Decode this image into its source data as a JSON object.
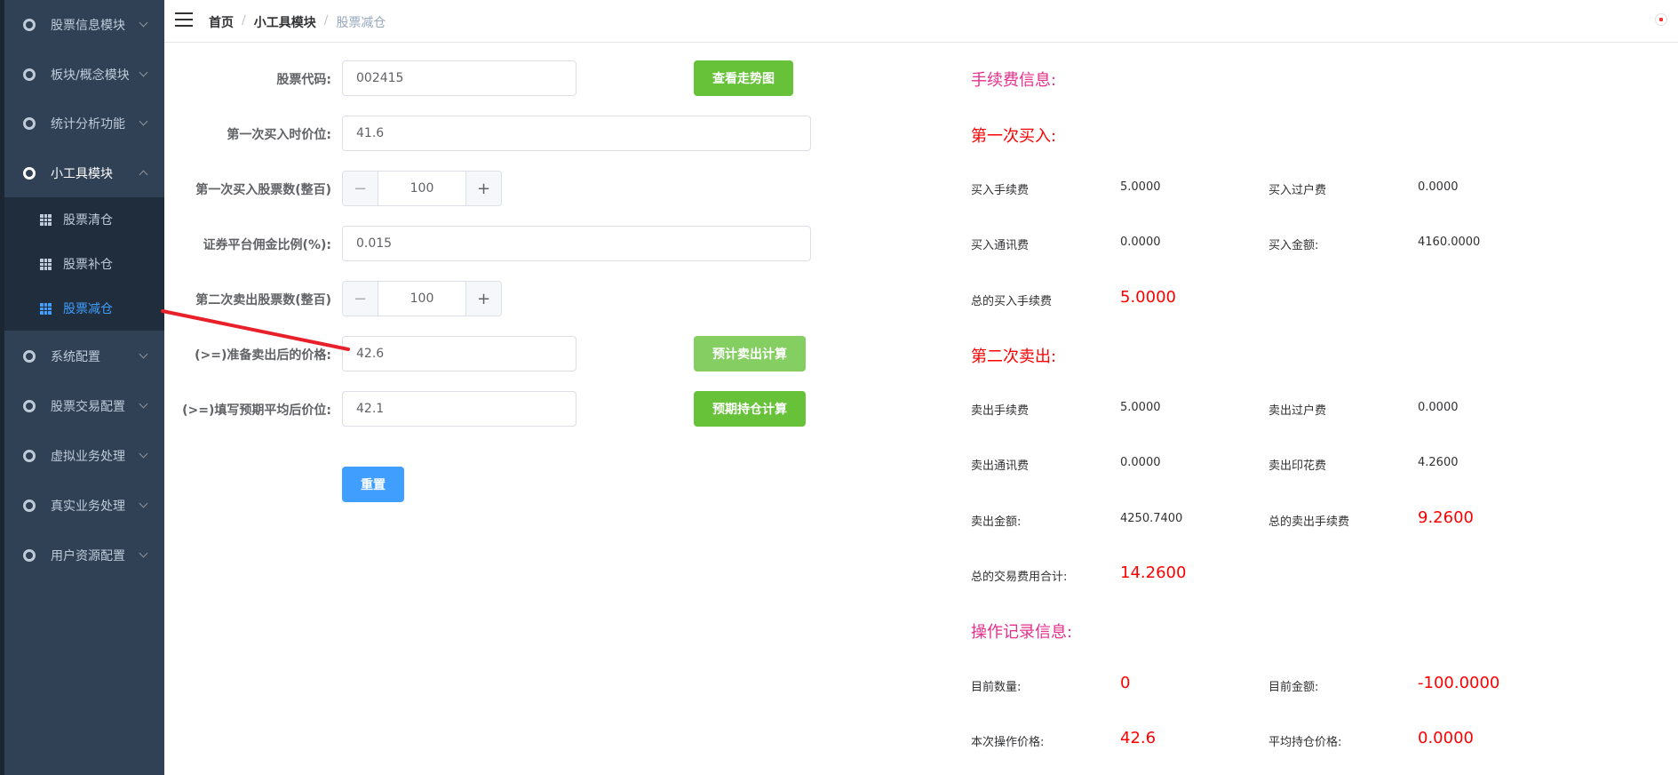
{
  "colors": {
    "sidebar_bg": "#304156",
    "accent": "#409eff",
    "green": "#67c23a",
    "pink_title": "#e62e8b",
    "red_value": "#ff0000"
  },
  "sidebar": {
    "menus": [
      {
        "label": "股票信息模块",
        "icon": "menu-circle-icon",
        "expanded": false
      },
      {
        "label": "板块/概念模块",
        "icon": "menu-circle-icon",
        "expanded": false
      },
      {
        "label": "统计分析功能",
        "icon": "menu-circle-icon",
        "expanded": false
      },
      {
        "label": "小工具模块",
        "icon": "menu-circle-icon",
        "expanded": true
      },
      {
        "label": "系统配置",
        "icon": "menu-circle-icon",
        "expanded": false
      },
      {
        "label": "股票交易配置",
        "icon": "menu-circle-icon",
        "expanded": false
      },
      {
        "label": "虚拟业务处理",
        "icon": "menu-circle-icon",
        "expanded": false
      },
      {
        "label": "真实业务处理",
        "icon": "menu-circle-icon",
        "expanded": false
      },
      {
        "label": "用户资源配置",
        "icon": "menu-circle-icon",
        "expanded": false
      }
    ],
    "submenu": [
      {
        "label": "股票清仓",
        "icon": "grid-icon",
        "active": false
      },
      {
        "label": "股票补仓",
        "icon": "grid-icon",
        "active": false
      },
      {
        "label": "股票减仓",
        "icon": "grid-icon",
        "active": true
      }
    ]
  },
  "header": {
    "breadcrumb": [
      "首页",
      "小工具模块",
      "股票减仓"
    ],
    "separator": "/"
  },
  "form": {
    "stock_code": {
      "label": "股票代码:",
      "value": "002415"
    },
    "view_trend_button": "查看走势图",
    "first_buy_price": {
      "label": "第一次买入时价位:",
      "value": "41.6"
    },
    "first_buy_shares": {
      "label": "第一次买入股票数(整百)",
      "value": "100",
      "minus": "−",
      "plus": "+"
    },
    "commission_rate": {
      "label": "证券平台佣金比例(%):",
      "value": "0.015"
    },
    "second_sell_shares": {
      "label": "第二次卖出股票数(整百)",
      "value": "100",
      "minus": "−",
      "plus": "+"
    },
    "target_sell_price": {
      "label": "(>=)准备卖出后的价格:",
      "value": "42.6"
    },
    "estimate_sell_button": "预计卖出计算",
    "target_avg_price": {
      "label": "(>=)填写预期平均后价位:",
      "value": "42.1"
    },
    "estimate_hold_button": "预期持仓计算",
    "reset_button": "重置"
  },
  "info": {
    "fee_title": "手续费信息:",
    "first_buy_title": "第一次买入:",
    "buy_fee_label": "买入手续费",
    "buy_fee": "5.0000",
    "buy_transfer_label": "买入过户费",
    "buy_transfer": "0.0000",
    "buy_comm_label": "买入通讯费",
    "buy_comm": "0.0000",
    "buy_amount_label": "买入金额:",
    "buy_amount": "4160.0000",
    "total_buy_fee_label": "总的买入手续费",
    "total_buy_fee": "5.0000",
    "second_sell_title": "第二次卖出:",
    "sell_fee_label": "卖出手续费",
    "sell_fee": "5.0000",
    "sell_transfer_label": "卖出过户费",
    "sell_transfer": "0.0000",
    "sell_comm_label": "卖出通讯费",
    "sell_comm": "0.0000",
    "sell_stamp_label": "卖出印花费",
    "sell_stamp": "4.2600",
    "sell_amount_label": "卖出金额:",
    "sell_amount": "4250.7400",
    "total_sell_fee_label": "总的卖出手续费",
    "total_sell_fee": "9.2600",
    "total_trade_fee_label": "总的交易费用合计:",
    "total_trade_fee": "14.2600",
    "op_title": "操作记录信息:",
    "cur_qty_label": "目前数量:",
    "cur_qty": "0",
    "cur_amount_label": "目前金额:",
    "cur_amount": "-100.0000",
    "op_price_label": "本次操作价格:",
    "op_price": "42.6",
    "avg_price_label": "平均持仓价格:",
    "avg_price": "0.0000"
  }
}
